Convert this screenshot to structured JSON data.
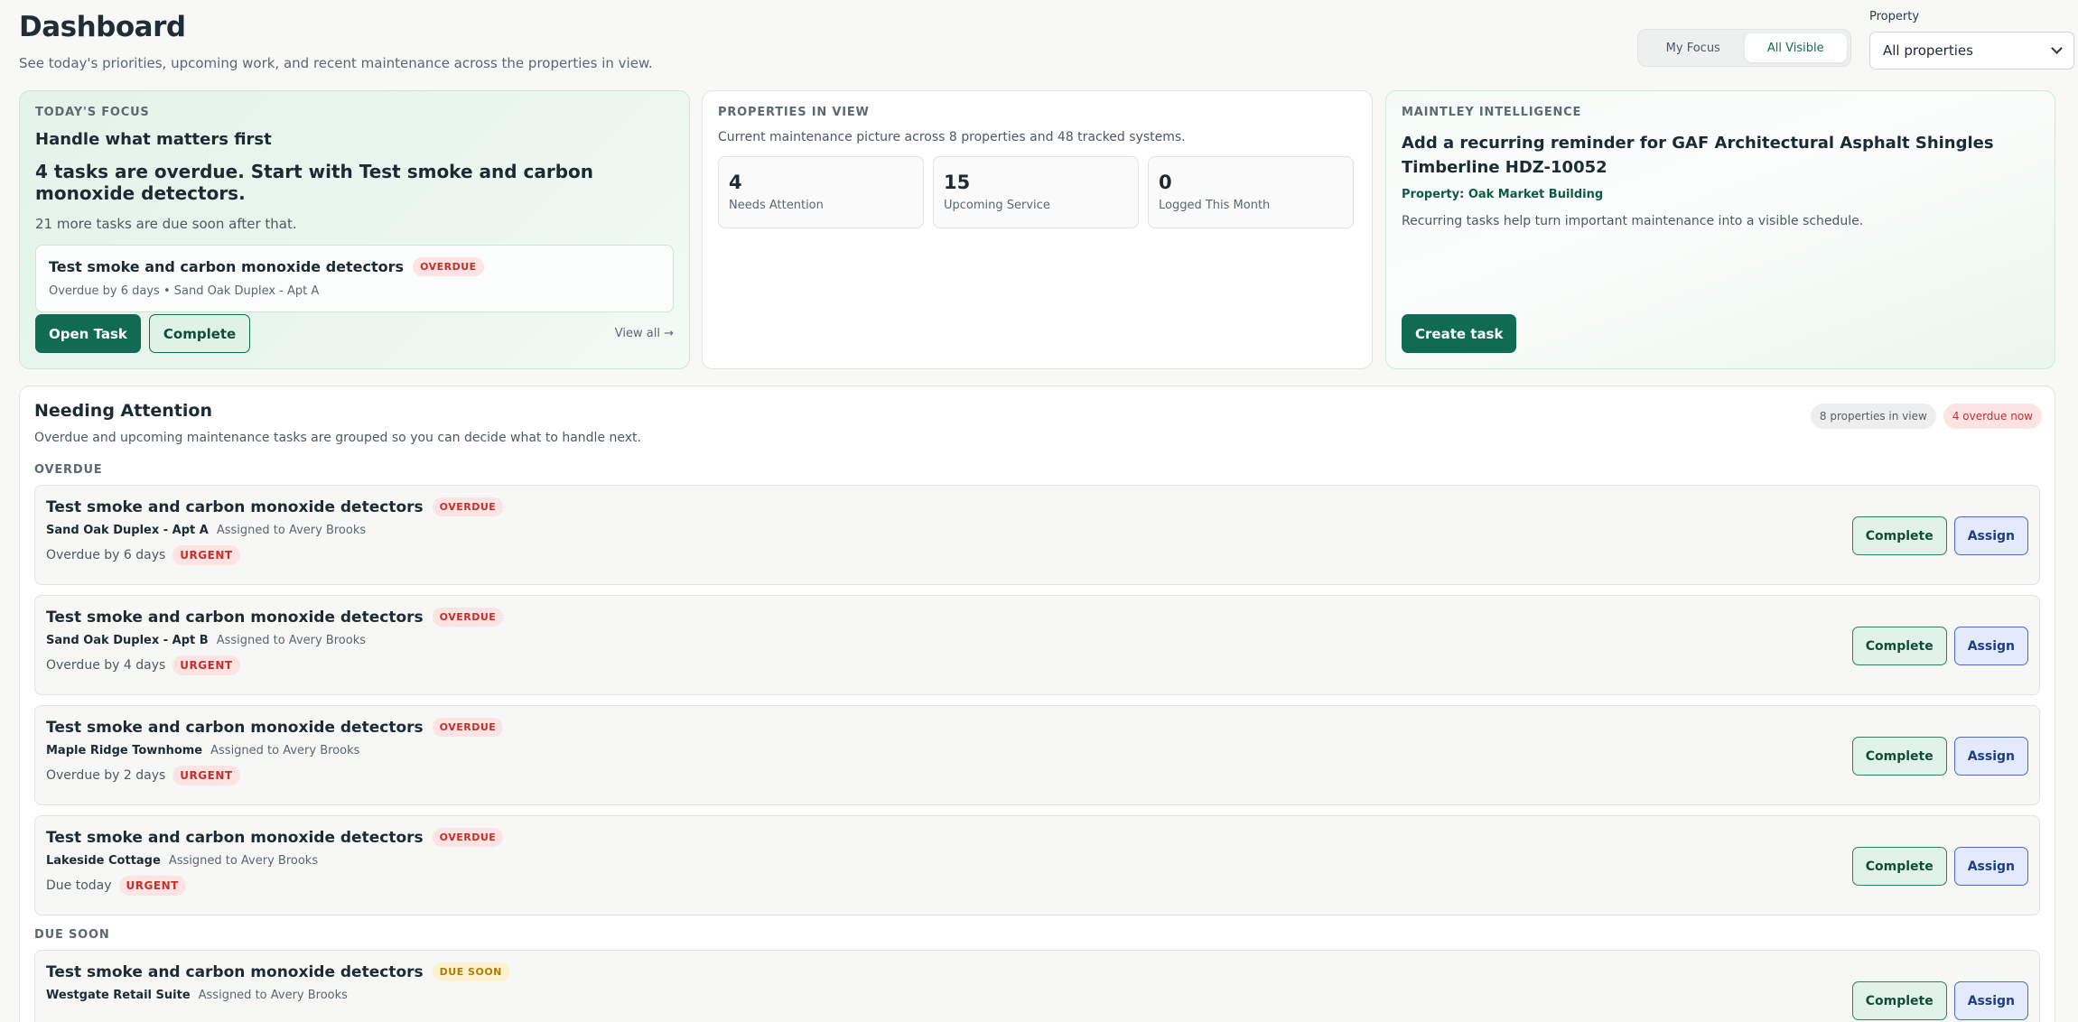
{
  "header": {
    "title": "Dashboard",
    "subtitle": "See today's priorities, upcoming work, and recent maintenance across the properties in view.",
    "toggle": {
      "my_focus": "My Focus",
      "all_visible": "All Visible"
    },
    "property_label": "Property",
    "property_value": "All properties"
  },
  "focus": {
    "eyebrow": "TODAY'S FOCUS",
    "heading": "Handle what matters first",
    "headline": "4 tasks are overdue. Start with Test smoke and carbon monoxide detectors.",
    "sub": "21 more tasks are due soon after that.",
    "task": {
      "title": "Test smoke and carbon monoxide detectors",
      "badge": "OVERDUE",
      "meta": "Overdue by 6 days • Sand Oak Duplex - Apt A"
    },
    "open_label": "Open Task",
    "complete_label": "Complete",
    "view_all": "View all →"
  },
  "properties": {
    "eyebrow": "PROPERTIES IN VIEW",
    "desc": "Current maintenance picture across 8 properties and 48 tracked systems.",
    "stats": [
      {
        "value": "4",
        "label": "Needs Attention"
      },
      {
        "value": "15",
        "label": "Upcoming Service"
      },
      {
        "value": "0",
        "label": "Logged This Month"
      }
    ]
  },
  "intel": {
    "eyebrow": "MAINTLEY INTELLIGENCE",
    "title": "Add a recurring reminder for GAF Architectural Asphalt Shingles Timberline HDZ-10052",
    "property": "Property: Oak Market Building",
    "desc": "Recurring tasks help turn important maintenance into a visible schedule.",
    "create_label": "Create task"
  },
  "attention": {
    "title": "Needing Attention",
    "desc": "Overdue and upcoming maintenance tasks are grouped so you can decide what to handle next.",
    "pill_props": "8 properties in view",
    "pill_overdue": "4 overdue now",
    "complete_label": "Complete",
    "assign_label": "Assign",
    "overdue_label": "OVERDUE",
    "overdue": [
      {
        "title": "Test smoke and carbon monoxide detectors",
        "badge": "OVERDUE",
        "property": "Sand Oak Duplex - Apt A",
        "assigned": "Assigned to Avery Brooks",
        "due": "Overdue by 6 days",
        "priority": "URGENT"
      },
      {
        "title": "Test smoke and carbon monoxide detectors",
        "badge": "OVERDUE",
        "property": "Sand Oak Duplex - Apt B",
        "assigned": "Assigned to Avery Brooks",
        "due": "Overdue by 4 days",
        "priority": "URGENT"
      },
      {
        "title": "Test smoke and carbon monoxide detectors",
        "badge": "OVERDUE",
        "property": "Maple Ridge Townhome",
        "assigned": "Assigned to Avery Brooks",
        "due": "Overdue by 2 days",
        "priority": "URGENT"
      },
      {
        "title": "Test smoke and carbon monoxide detectors",
        "badge": "OVERDUE",
        "property": "Lakeside Cottage",
        "assigned": "Assigned to Avery Brooks",
        "due": "Due today",
        "priority": "URGENT"
      }
    ],
    "due_soon_label": "DUE SOON",
    "due_soon": [
      {
        "title": "Test smoke and carbon monoxide detectors",
        "badge": "DUE SOON",
        "property": "Westgate Retail Suite",
        "assigned": "Assigned to Avery Brooks"
      }
    ]
  }
}
